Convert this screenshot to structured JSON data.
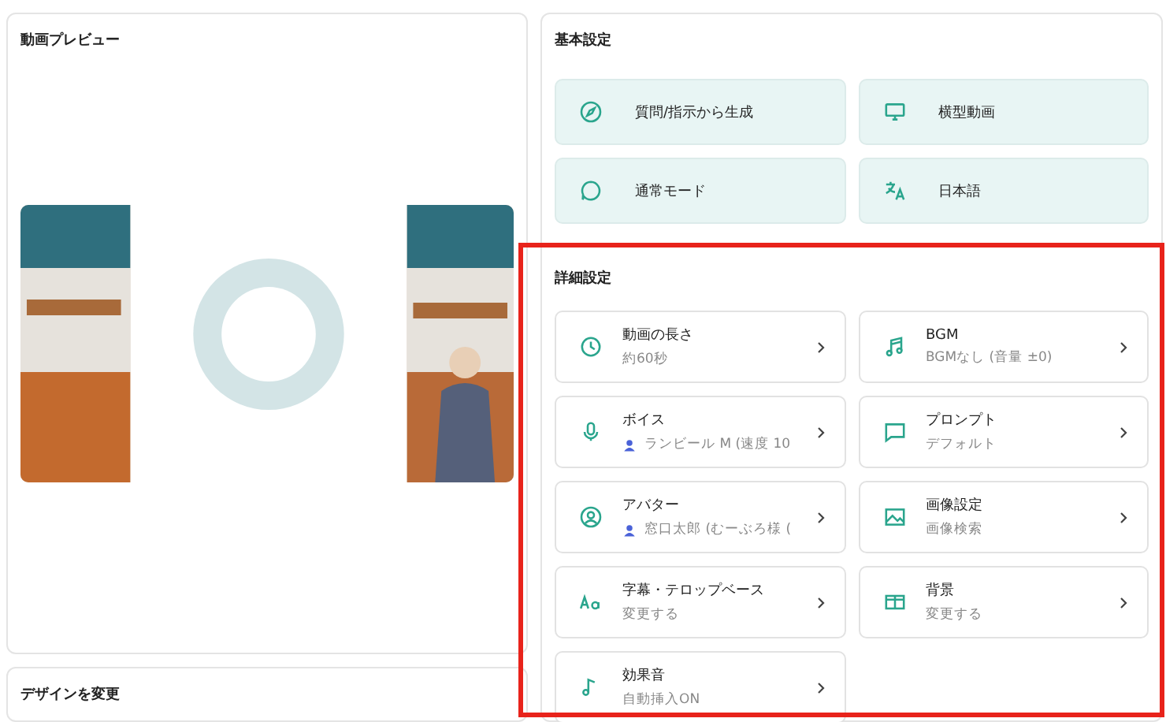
{
  "preview": {
    "title": "動画プレビュー"
  },
  "design": {
    "title": "デザインを変更"
  },
  "basic": {
    "title": "基本設定",
    "items": [
      {
        "label": "質問/指示から生成"
      },
      {
        "label": "横型動画"
      },
      {
        "label": "通常モード"
      },
      {
        "label": "日本語"
      }
    ]
  },
  "detail": {
    "title": "詳細設定",
    "highlighted": true,
    "items": [
      {
        "label": "動画の長さ",
        "value": "約60秒",
        "badge": false
      },
      {
        "label": "BGM",
        "value": "BGMなし (音量 ±0)",
        "badge": false
      },
      {
        "label": "ボイス",
        "value": "ランビール M (速度 10",
        "badge": true
      },
      {
        "label": "プロンプト",
        "value": "デフォルト",
        "badge": false
      },
      {
        "label": "アバター",
        "value": "窓口太郎 (むーぶろ様 (",
        "badge": true
      },
      {
        "label": "画像設定",
        "value": "画像検索",
        "badge": false
      },
      {
        "label": "字幕・テロップベース",
        "value": "変更する",
        "badge": false
      },
      {
        "label": "背景",
        "value": "変更する",
        "badge": false
      },
      {
        "label": "効果音",
        "value": "自動挿入ON",
        "badge": false
      }
    ]
  }
}
